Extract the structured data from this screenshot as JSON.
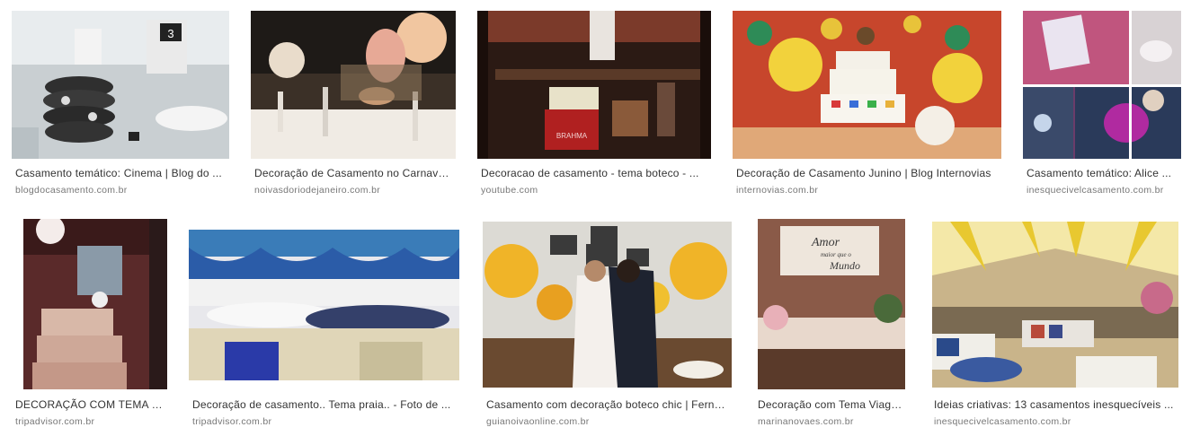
{
  "results": [
    {
      "title": "Casamento temático: Cinema | Blog do ...",
      "source": "blogdocasamento.com.br"
    },
    {
      "title": "Decoração de Casamento no Carnaval ...",
      "source": "noivasdoriodejaneiro.com.br"
    },
    {
      "title": "Decoracao de casamento - tema boteco - ...",
      "source": "youtube.com"
    },
    {
      "title": "Decoração de Casamento Junino | Blog Internovias",
      "source": "internovias.com.br"
    },
    {
      "title": "Casamento temático: Alice ...",
      "source": "inesquecivelcasamento.com.br"
    },
    {
      "title": "DECORAÇÃO COM TEMA - ...",
      "source": "tripadvisor.com.br"
    },
    {
      "title": "Decoração de casamento.. Tema praia.. - Foto de ...",
      "source": "tripadvisor.com.br"
    },
    {
      "title": "Casamento com decoração boteco chic | Fernanda ...",
      "source": "guianoivaonline.com.br"
    },
    {
      "title": "Decoração com Tema Viagem ...",
      "source": "marinanovaes.com.br"
    },
    {
      "title": "Ideias criativas: 13 casamentos inesquecíveis ...",
      "source": "inesquecivelcasamento.com.br"
    }
  ],
  "image_text": {
    "clapper_number": "3",
    "sign_line1": "Amor",
    "sign_line2": "maior que o",
    "sign_line3": "Mundo",
    "crate_label": "BRAHMA"
  }
}
